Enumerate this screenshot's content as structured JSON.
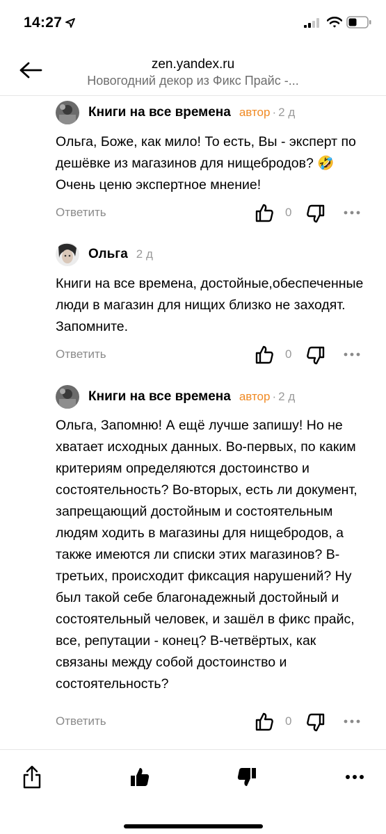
{
  "status_bar": {
    "time": "14:27",
    "icons": [
      "location-arrow-icon",
      "cellular-signal-icon",
      "wifi-icon",
      "battery-icon"
    ]
  },
  "nav": {
    "domain": "zen.yandex.ru",
    "title": "Новогодний декор из Фикс Прайс -..."
  },
  "comments": [
    {
      "author": "Книги на все времена",
      "badge": "автор",
      "separator": "·",
      "time": "2 д",
      "text": "Ольга, Боже, как мило! То есть, Вы - эксперт по дешёвке из магазинов для нищебродов? 🤣 Очень ценю экспертное мнение!",
      "reply_label": "Ответить",
      "likes": "0"
    },
    {
      "author": "Ольга",
      "badge": "",
      "separator": "",
      "time": "2 д",
      "text": "Книги на все времена, достойные,обеспеченные люди в магазин для нищих близко не заходят. Запомните.",
      "reply_label": "Ответить",
      "likes": "0"
    },
    {
      "author": "Книги на все времена",
      "badge": "автор",
      "separator": "·",
      "time": "2 д",
      "text": "Ольга, Запомню! А ещё лучше запишу! Но не хватает исходных данных. Во-первых, по каким критериям определяются достоинство и состоятельность? Во-вторых, есть ли документ, запрещающий достойным и состоятельным людям ходить в магазины для нищебродов, а также имеются ли списки этих магазинов? В-третьих, происходит фиксация нарушений? Ну был такой себе благонадежный достойный и состоятельный человек, и зашёл в фикс прайс, все, репутации - конец? В-четвёртых, как связаны между собой достоинство и состоятельность?",
      "reply_label": "Ответить",
      "likes": "0"
    }
  ],
  "colors": {
    "author_badge": "#f08a24",
    "meta_gray": "#9a9a9a",
    "reply_gray": "#8a8a8a"
  },
  "toolbar": {
    "icons": [
      "share-icon",
      "thumbs-up-filled-icon",
      "thumbs-down-filled-icon",
      "more-horizontal-icon"
    ]
  }
}
